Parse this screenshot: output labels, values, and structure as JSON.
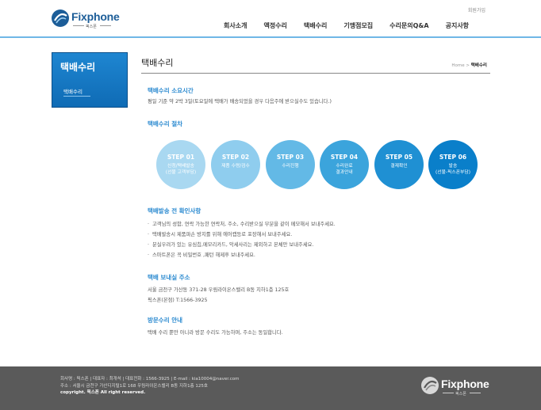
{
  "header": {
    "logo_text": "Fixphone",
    "logo_sub": "픽스폰",
    "member_link": "회원가입",
    "nav": [
      "회사소개",
      "액정수리",
      "택배수리",
      "기맹점모집",
      "수리문의Q&A",
      "공지사항"
    ]
  },
  "sidebar": {
    "title": "택배수리",
    "items": [
      {
        "label": "택배수리"
      }
    ]
  },
  "content": {
    "page_title": "택배수리",
    "breadcrumb_home": "Home",
    "breadcrumb_sep": ">",
    "breadcrumb_current": "택배수리",
    "time_heading": "택배수리 소요시간",
    "time_text": "평일 기준 약 2박 3일(토요일에 택배가 배송되었을 경우 다음주에 받으실수도 있습니다.)",
    "process_heading": "택배수리 절차",
    "steps": [
      {
        "num": "STEP 01",
        "desc": "신청/택배발송\n(선불 고객부담)",
        "color": "#a9d8f1"
      },
      {
        "num": "STEP 02",
        "desc": "제품 수령/검수",
        "color": "#8fcdee"
      },
      {
        "num": "STEP 03",
        "desc": "수리진행",
        "color": "#63b9e6"
      },
      {
        "num": "STEP 04",
        "desc": "수리완료\n결과안내",
        "color": "#3ba4dc"
      },
      {
        "num": "STEP 05",
        "desc": "결제확인",
        "color": "#1f90d3"
      },
      {
        "num": "STEP 06",
        "desc": "발송\n(선불-픽스폰부담)",
        "color": "#0a7fca"
      }
    ],
    "check_heading": "택배발송 전 확인사항",
    "check_items": [
      "고객님의 성함, 연락 가능한 연락처, 주소, 수리받으실 부분을 같이 메모해서 보내주세요.",
      "택배발송시 제품파손 방지를 위해 에어캡등로 포장해서 보내주세요.",
      "분실우려가 있는 유심칩,메모리카드, 악세사리는 제외하고 본체만 보내주세요.",
      "스마트폰은 꼭 비밀번호 ,패턴 해제후 보내주세요."
    ],
    "address_heading": "택배 보내실 주소",
    "address_line1": "서울 금천구 가산동 371-28 우림라이온스밸리 B동 지하1층 125호",
    "address_line2": "픽스폰(본점) T:1566-3925",
    "visit_heading": "방문수리 안내",
    "visit_text": "택배 수리 뿐만 아니라 방문 수리도 가능하며, 주소는 동일합니다."
  },
  "footer": {
    "line1": "회사명 : 픽스폰  |  대표자 : 최개석  |  대표전화 : 1566-3925  |  E-mail : kia10004@naver.com",
    "line2": "주소 : 서울시 금천구 가산디지털1로 168 우림라이온스밸리 B동 지하1층 125호",
    "copyright": "copyright. 픽스폰 All right reserved.",
    "logo_text": "Fixphone",
    "logo_sub": "픽스폰"
  },
  "colors": {
    "brand": "#1c5d98",
    "accent": "#2b8ad0",
    "footer_bg": "#5a5a5a"
  }
}
